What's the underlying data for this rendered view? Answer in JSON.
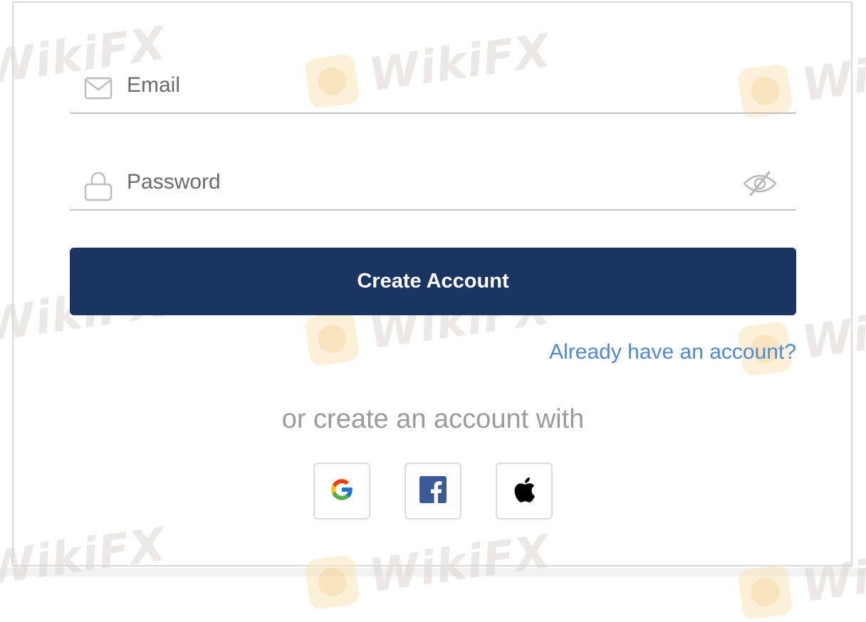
{
  "form": {
    "email": {
      "placeholder": "Email",
      "value": "",
      "icon": "mail-icon"
    },
    "password": {
      "placeholder": "Password",
      "value": "",
      "icon": "lock-icon",
      "toggle_icon": "eye-slash-icon"
    },
    "submit_label": "Create Account",
    "signin_link": "Already have an account?",
    "alt_signup_text": "or create an account with"
  },
  "social": [
    {
      "name": "google",
      "icon": "google-icon"
    },
    {
      "name": "facebook",
      "icon": "facebook-icon"
    },
    {
      "name": "apple",
      "icon": "apple-icon"
    }
  ],
  "watermark": {
    "text": "WikiFX"
  },
  "colors": {
    "primary_button": "#1b3563",
    "link": "#4d8ad3",
    "muted_text": "#9b9b9b",
    "field_border": "#c2c2c2",
    "watermark_text": "#ddd6d3",
    "watermark_logo": "#fbe6b9"
  }
}
